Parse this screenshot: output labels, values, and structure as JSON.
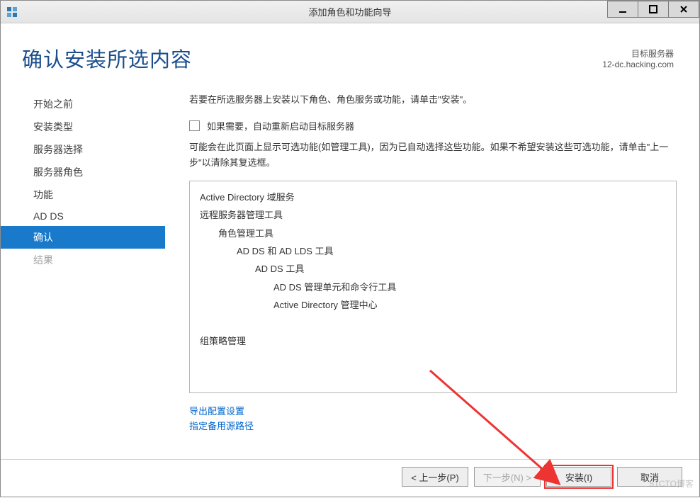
{
  "titlebar": {
    "title": "添加角色和功能向导"
  },
  "header": {
    "page_title": "确认安装所选内容",
    "target_label": "目标服务器",
    "target_value": "12-dc.hacking.com"
  },
  "sidebar": {
    "items": [
      {
        "label": "开始之前",
        "state": "normal"
      },
      {
        "label": "安装类型",
        "state": "normal"
      },
      {
        "label": "服务器选择",
        "state": "normal"
      },
      {
        "label": "服务器角色",
        "state": "normal"
      },
      {
        "label": "功能",
        "state": "normal"
      },
      {
        "label": "AD DS",
        "state": "normal"
      },
      {
        "label": "确认",
        "state": "active"
      },
      {
        "label": "结果",
        "state": "disabled"
      }
    ]
  },
  "main": {
    "intro": "若要在所选服务器上安装以下角色、角色服务或功能，请单击\"安装\"。",
    "checkbox_label": "如果需要，自动重新启动目标服务器",
    "note": "可能会在此页面上显示可选功能(如管理工具)，因为已自动选择这些功能。如果不希望安装这些可选功能，请单击\"上一步\"以清除其复选框。",
    "list": [
      {
        "text": "Active Directory 域服务",
        "indent": 0
      },
      {
        "text": "远程服务器管理工具",
        "indent": 0
      },
      {
        "text": "角色管理工具",
        "indent": 1
      },
      {
        "text": "AD DS 和 AD LDS 工具",
        "indent": 2
      },
      {
        "text": "AD DS 工具",
        "indent": 3
      },
      {
        "text": "AD DS 管理单元和命令行工具",
        "indent": 4
      },
      {
        "text": "Active Directory 管理中心",
        "indent": 4
      },
      {
        "text": "",
        "indent": 0
      },
      {
        "text": "组策略管理",
        "indent": 0
      }
    ],
    "links": {
      "export": "导出配置设置",
      "alt_source": "指定备用源路径"
    }
  },
  "footer": {
    "prev": "< 上一步(P)",
    "next": "下一步(N) >",
    "install": "安装(I)",
    "cancel": "取消"
  },
  "watermark": "51CTO博客"
}
